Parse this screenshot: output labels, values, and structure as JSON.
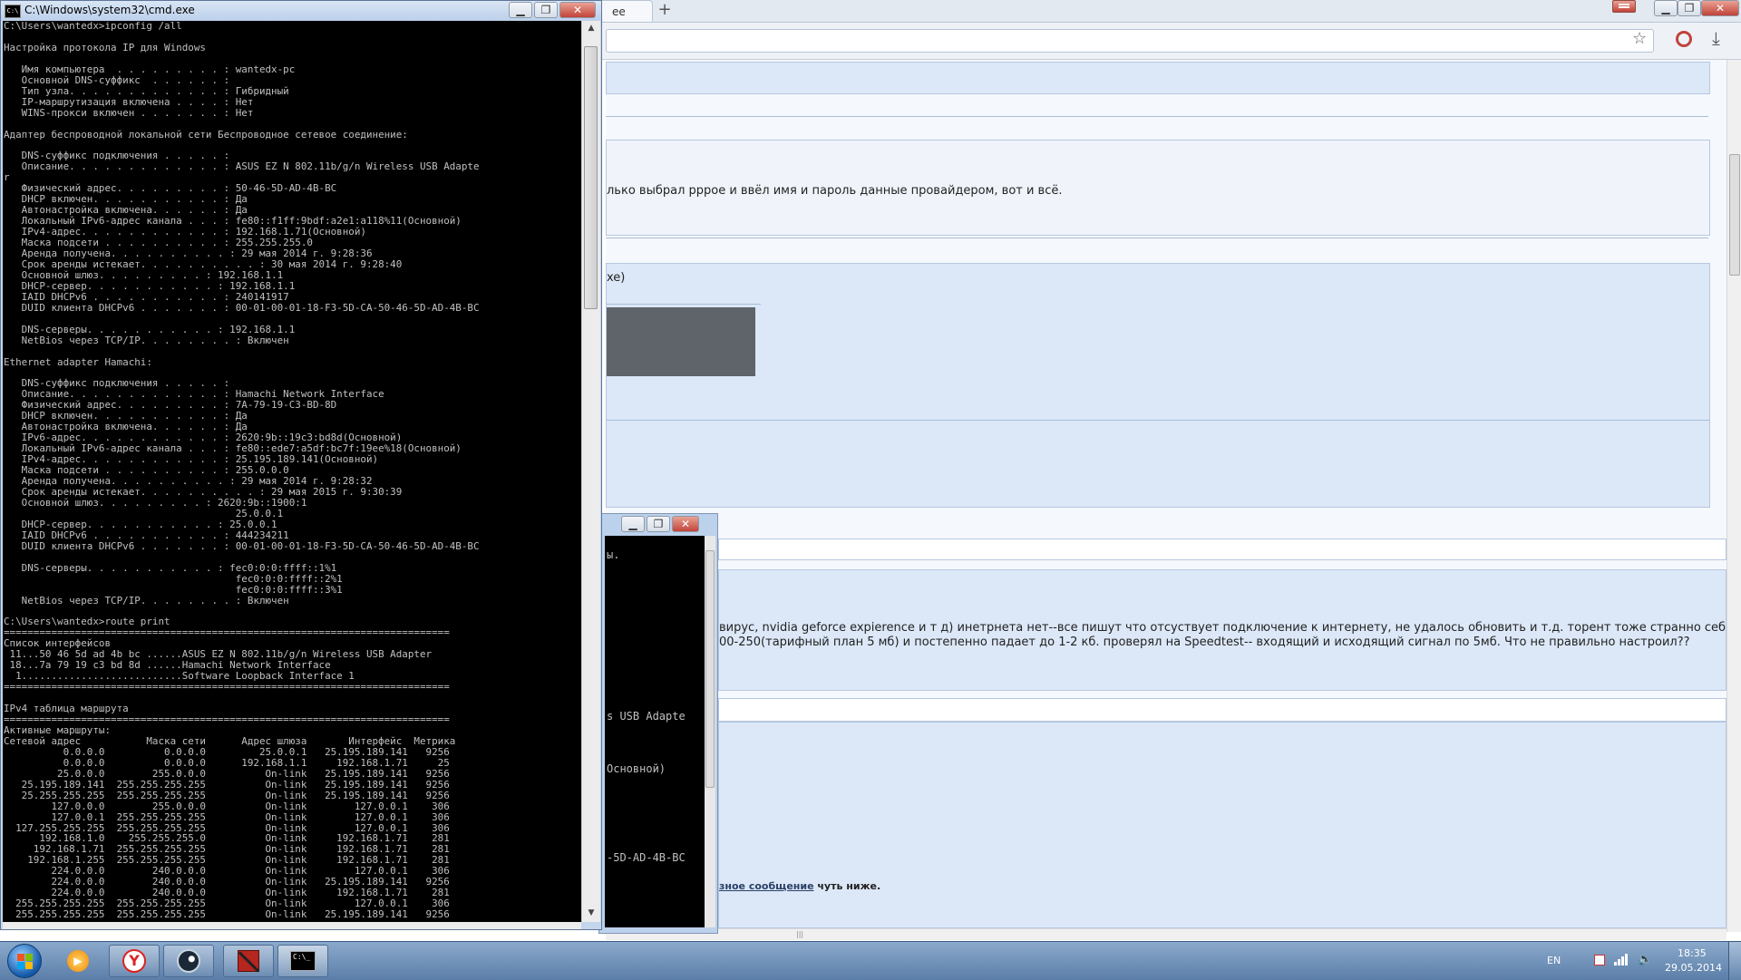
{
  "browser": {
    "tab_label": "ee",
    "new_tab_glyph": "+",
    "forum": {
      "line1": "лько выбрал pppoe и ввёл имя и пароль данные провайдером, вот и всё.",
      "line2": "xe)",
      "line3": "вирус, nvidia geforce expierence и т д) инетрнета нет--все пишут что отсуствует подключение к интернету, не удалось обновить и т.д. торент тоже странно себя ведёт--",
      "line4": "00-250(тарифный план 5 мб) и постепенно падает до 1-2 кб. проверял на Speedtest-- входящий и исходящий сигнал по 5мб. Что не правильно настроил??",
      "link_text": "зное сообщение",
      "after_link": " чуть ниже."
    }
  },
  "cmd2": {
    "lines": [
      "ы.",
      "s USB Adapte",
      "Основной)",
      "-5D-AD-4B-BC"
    ]
  },
  "cmd": {
    "title": "C:\\Windows\\system32\\cmd.exe",
    "output": "C:\\Users\\wantedx>ipconfig /all\n\nНастройка протокола IP для Windows\n\n   Имя компьютера  . . . . . . . . . : wantedx-pc\n   Основной DNS-суффикс  . . . . . . :\n   Тип узла. . . . . . . . . . . . . : Гибридный\n   IP-маршрутизация включена . . . . : Нет\n   WINS-прокси включен . . . . . . . : Нет\n\nАдаптер беспроводной локальной сети Беспроводное сетевое соединение:\n\n   DNS-суффикс подключения . . . . . :\n   Описание. . . . . . . . . . . . . : ASUS EZ N 802.11b/g/n Wireless USB Adapte\nr\n   Физический адрес. . . . . . . . . : 50-46-5D-AD-4B-BC\n   DHCP включен. . . . . . . . . . . : Да\n   Автонастройка включена. . . . . . : Да\n   Локальный IPv6-адрес канала . . . : fe80::f1ff:9bdf:a2e1:a118%11(Основной)\n   IPv4-адрес. . . . . . . . . . . . : 192.168.1.71(Основной)\n   Маска подсети . . . . . . . . . . : 255.255.255.0\n   Аренда получена. . . . . . . . . . : 29 мая 2014 г. 9:28:36\n   Срок аренды истекает. . . . . . . . . . : 30 мая 2014 г. 9:28:40\n   Основной шлюз. . . . . . . . . : 192.168.1.1\n   DHCP-сервер. . . . . . . . . . . : 192.168.1.1\n   IAID DHCPv6 . . . . . . . . . . . : 240141917\n   DUID клиента DHCPv6 . . . . . . . : 00-01-00-01-18-F3-5D-CA-50-46-5D-AD-4B-BC\n\n   DNS-серверы. . . . . . . . . . . : 192.168.1.1\n   NetBios через TCP/IP. . . . . . . . : Включен\n\nEthernet adapter Hamachi:\n\n   DNS-суффикс подключения . . . . . :\n   Описание. . . . . . . . . . . . . : Hamachi Network Interface\n   Физический адрес. . . . . . . . . : 7A-79-19-C3-BD-8D\n   DHCP включен. . . . . . . . . . . : Да\n   Автонастройка включена. . . . . . : Да\n   IPv6-адрес. . . . . . . . . . . . : 2620:9b::19c3:bd8d(Основной)\n   Локальный IPv6-адрес канала . . . : fe80::ede7:a5df:bc7f:19ee%18(Основной)\n   IPv4-адрес. . . . . . . . . . . . : 25.195.189.141(Основной)\n   Маска подсети . . . . . . . . . . : 255.0.0.0\n   Аренда получена. . . . . . . . . . : 29 мая 2014 г. 9:28:32\n   Срок аренды истекает. . . . . . . . . . : 29 мая 2015 г. 9:30:39\n   Основной шлюз. . . . . . . . . : 2620:9b::1900:1\n                                       25.0.0.1\n   DHCP-сервер. . . . . . . . . . . : 25.0.0.1\n   IAID DHCPv6 . . . . . . . . . . . : 444234211\n   DUID клиента DHCPv6 . . . . . . . : 00-01-00-01-18-F3-5D-CA-50-46-5D-AD-4B-BC\n\n   DNS-серверы. . . . . . . . . . . : fec0:0:0:ffff::1%1\n                                       fec0:0:0:ffff::2%1\n                                       fec0:0:0:ffff::3%1\n   NetBios через TCP/IP. . . . . . . . : Включен\n\nC:\\Users\\wantedx>route print\n===========================================================================\nСписок интерфейсов\n 11...50 46 5d ad 4b bc ......ASUS EZ N 802.11b/g/n Wireless USB Adapter\n 18...7a 79 19 c3 bd 8d ......Hamachi Network Interface\n  1...........................Software Loopback Interface 1\n===========================================================================\n\nIPv4 таблица маршрута\n===========================================================================\nАктивные маршруты:\nСетевой адрес           Маска сети      Адрес шлюза       Интерфейс  Метрика\n          0.0.0.0          0.0.0.0         25.0.0.1   25.195.189.141   9256\n          0.0.0.0          0.0.0.0      192.168.1.1     192.168.1.71     25\n         25.0.0.0        255.0.0.0          On-link   25.195.189.141   9256\n   25.195.189.141  255.255.255.255          On-link   25.195.189.141   9256\n   25.255.255.255  255.255.255.255          On-link   25.195.189.141   9256\n        127.0.0.0        255.0.0.0          On-link        127.0.0.1    306\n        127.0.0.1  255.255.255.255          On-link        127.0.0.1    306\n  127.255.255.255  255.255.255.255          On-link        127.0.0.1    306\n      192.168.1.0    255.255.255.0          On-link     192.168.1.71    281\n     192.168.1.71  255.255.255.255          On-link     192.168.1.71    281\n    192.168.1.255  255.255.255.255          On-link     192.168.1.71    281\n        224.0.0.0        240.0.0.0          On-link        127.0.0.1    306\n        224.0.0.0        240.0.0.0          On-link   25.195.189.141   9256\n        224.0.0.0        240.0.0.0          On-link     192.168.1.71    281\n  255.255.255.255  255.255.255.255          On-link        127.0.0.1    306\n  255.255.255.255  255.255.255.255          On-link   25.195.189.141   9256"
  },
  "window_buttons": {
    "minimize": "▁",
    "maximize": "❐",
    "close": "✕"
  },
  "taskbar": {
    "cmd_icon_text": "C:\\_",
    "lang": "EN",
    "time": "18:35",
    "date": "29.05.2014"
  },
  "colors": {
    "accent": "#1a5fb0",
    "close_button": "#c1433a",
    "console_text": "#c0c0c0",
    "forum_row": "#dce8f8"
  }
}
